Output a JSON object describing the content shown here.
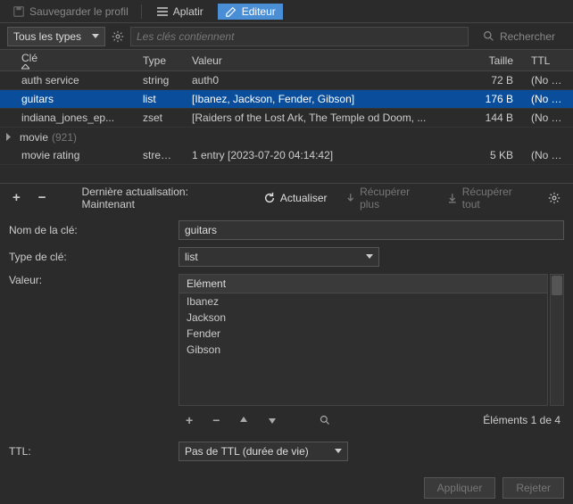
{
  "toolbar": {
    "save_profile": "Sauvegarder le profil",
    "flatten": "Aplatir",
    "editor": "Editeur"
  },
  "filter": {
    "all_types": "Tous les types",
    "keys_placeholder": "Les clés contiennent",
    "search_label": "Rechercher"
  },
  "columns": {
    "key": "Clé",
    "type": "Type",
    "value": "Valeur",
    "size": "Taille",
    "ttl": "TTL"
  },
  "rows": [
    {
      "key": "auth service",
      "type": "string",
      "value": "auth0",
      "size": "72 B",
      "ttl": "(No T..."
    },
    {
      "key": "guitars",
      "type": "list",
      "value": "[Ibanez, Jackson, Fender, Gibson]",
      "size": "176 B",
      "ttl": "(No T..."
    },
    {
      "key": "indiana_jones_ep...",
      "type": "zset",
      "value": "[Raiders of the Lost Ark, The Temple od Doom, ...",
      "size": "144 B",
      "ttl": "(No T..."
    }
  ],
  "group": {
    "label": "movie",
    "count": "(921)"
  },
  "stream_row": {
    "key": "movie rating",
    "type": "stream",
    "value": "1 entry [2023-07-20 04:14:42]",
    "size": "5 KB",
    "ttl": "(No T..."
  },
  "refresh_bar": {
    "last_refresh_label": "Dernière actualisation:",
    "last_refresh_value": "Maintenant",
    "refresh": "Actualiser",
    "fetch_more": "Récupérer plus",
    "fetch_all": "Récupérer tout"
  },
  "form": {
    "key_label": "Nom de la clé:",
    "key_value": "guitars",
    "type_label": "Type de clé:",
    "type_value": "list",
    "value_label": "Valeur:",
    "element_header": "Elément",
    "items": [
      "Ibanez",
      "Jackson",
      "Fender",
      "Gibson"
    ],
    "elements_count": "Éléments 1 de 4",
    "ttl_label": "TTL:",
    "ttl_value": "Pas de TTL (durée de vie)"
  },
  "buttons": {
    "apply": "Appliquer",
    "reject": "Rejeter"
  }
}
